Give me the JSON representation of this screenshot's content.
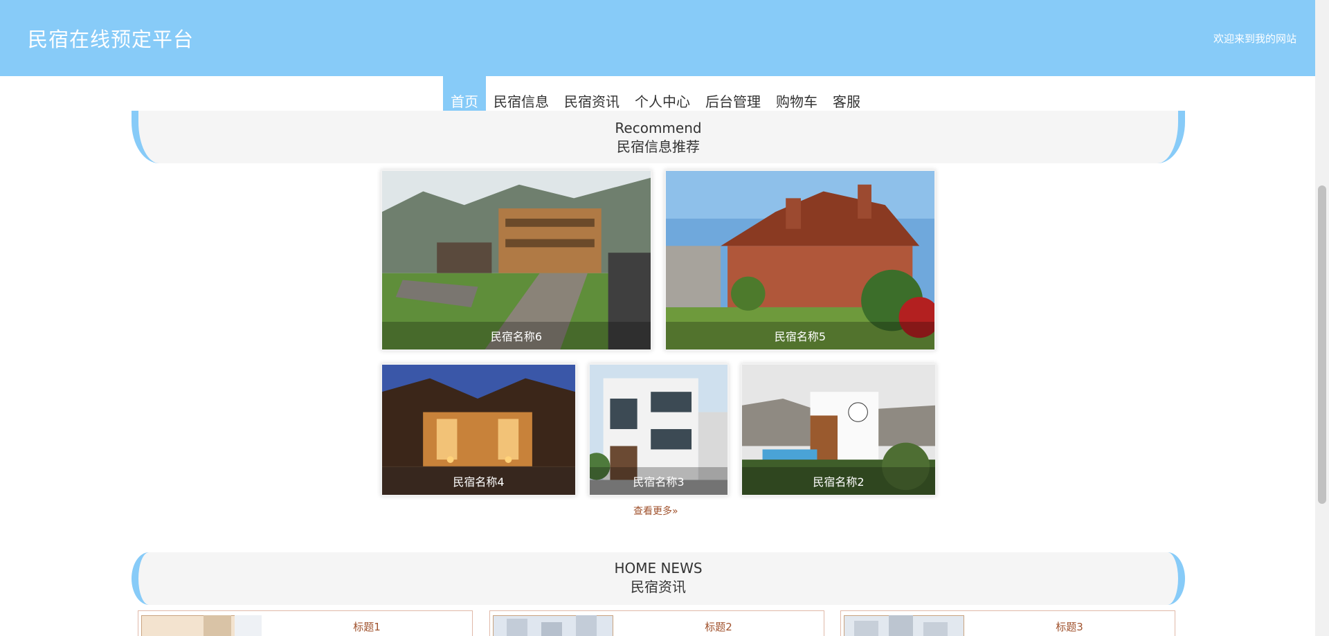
{
  "header": {
    "site_title": "民宿在线预定平台",
    "welcome": "欢迎来到我的网站",
    "bg_color": "#87cbf8"
  },
  "nav": {
    "items": [
      "首页",
      "民宿信息",
      "民宿资讯",
      "个人中心",
      "后台管理",
      "购物车",
      "客服"
    ],
    "active_index": 0
  },
  "recommend": {
    "title_en": "Recommend",
    "title_cn": "民宿信息推荐",
    "cards": [
      {
        "name": "民宿名称6"
      },
      {
        "name": "民宿名称5"
      },
      {
        "name": "民宿名称4"
      },
      {
        "name": "民宿名称3"
      },
      {
        "name": "民宿名称2"
      }
    ],
    "more_label": "查看更多"
  },
  "news": {
    "title_en": "HOME NEWS",
    "title_cn": "民宿资讯",
    "items": [
      {
        "title": "标题1"
      },
      {
        "title": "标题2"
      },
      {
        "title": "标题3"
      }
    ]
  }
}
